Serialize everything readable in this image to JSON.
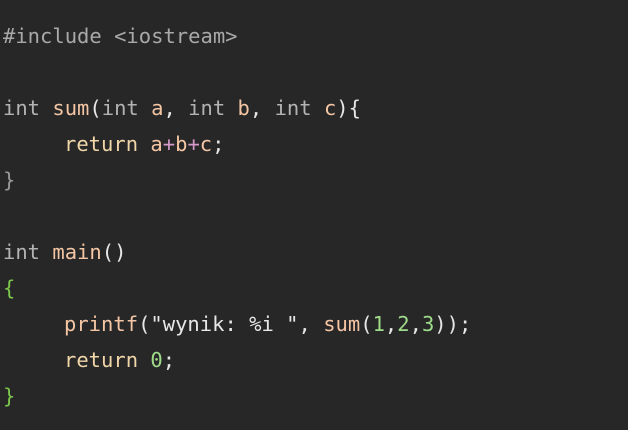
{
  "code": {
    "line1": {
      "directive": "#include <iostream>"
    },
    "line3": {
      "type1": "int",
      "name": "sum",
      "open": "(",
      "type2": "int",
      "p1": "a",
      "c1": ", ",
      "type3": "int",
      "p2": "b",
      "c2": ", ",
      "type4": "int",
      "p3": "c",
      "close": "){"
    },
    "line4": {
      "kw": "return",
      "a": "a",
      "op1": "+",
      "b": "b",
      "op2": "+",
      "c": "c",
      "semi": ";"
    },
    "line5": {
      "brace": "}"
    },
    "line7": {
      "type": "int",
      "name": "main",
      "parens": "()"
    },
    "line8": {
      "brace": "{"
    },
    "line9": {
      "fn": "printf",
      "open": "(",
      "str": "\"wynik: %i \"",
      "comma": ", ",
      "fn2": "sum",
      "open2": "(",
      "n1": "1",
      "cm1": ",",
      "n2": "2",
      "cm2": ",",
      "n3": "3",
      "close": "));"
    },
    "line10": {
      "kw": "return",
      "num": "0",
      "semi": ";"
    },
    "line11": {
      "brace": "}"
    }
  },
  "colors": {
    "background": "#272727",
    "function_name": "#f4c6a4",
    "keyword": "#f0d6a8",
    "operator": "#d59ac9",
    "number": "#9fdc8a",
    "brace_green": "#7cc84c"
  }
}
